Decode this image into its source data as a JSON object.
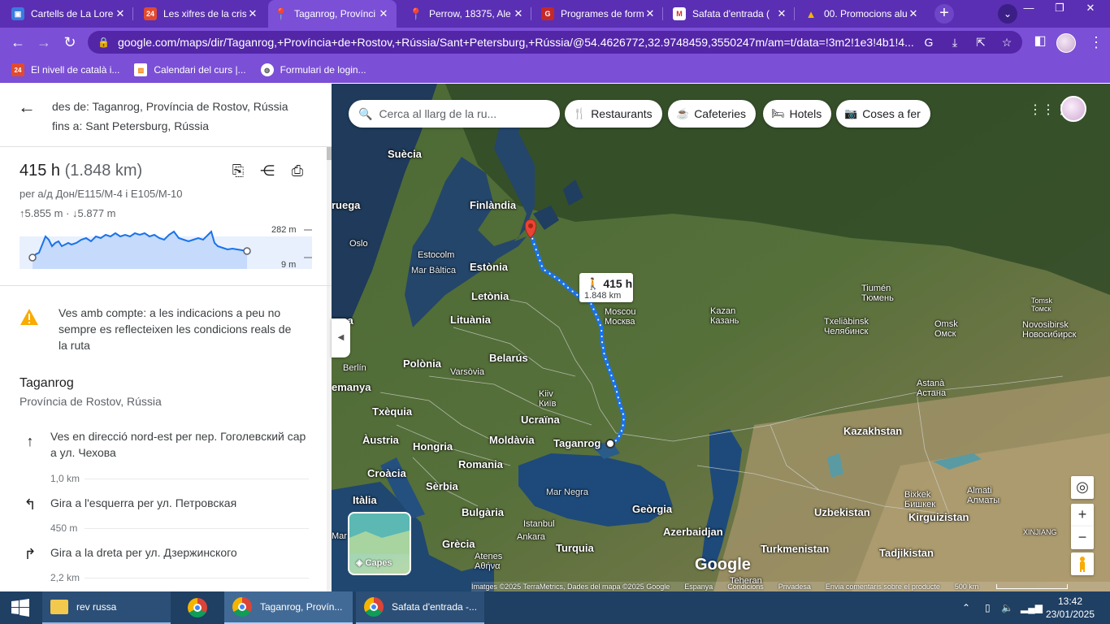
{
  "browser": {
    "tabs": [
      {
        "title": "Cartells de La Lore",
        "favicon": "yellow-square-icon",
        "color": "#3b7be0"
      },
      {
        "title": "Les xifres de la cris",
        "favicon": "324-icon",
        "color": "#e24a2f"
      },
      {
        "title": "Taganrog, Provínci",
        "favicon": "maps-pin-icon",
        "color": "#34a853"
      },
      {
        "title": "Perrow, 18375, Ale",
        "favicon": "maps-pin-icon",
        "color": "#34a853"
      },
      {
        "title": "Programes de form",
        "favicon": "gen-cat-icon",
        "color": "#c62828"
      },
      {
        "title": "Safata d'entrada (",
        "favicon": "gmail-icon",
        "color": "#d93025"
      },
      {
        "title": "00. Promocions alu",
        "favicon": "drive-icon",
        "color": "#1e8e3e"
      }
    ],
    "new_tab": "+",
    "url_domain": "google.com",
    "url_path": "/maps/dir/Taganrog,+Província+de+Rostov,+Rússia/Sant+Petersburg,+Rússia/@54.4626772,32.9748459,3550247m/am=t/data=!3m2!1e3!4b1!4...",
    "bookmarks": [
      {
        "label": "El nivell de català i...",
        "icon": "324-icon"
      },
      {
        "label": "Calendari del curs |...",
        "icon": "calendar-icon"
      },
      {
        "label": "Formulari de login...",
        "icon": "globe-icon"
      }
    ]
  },
  "directions": {
    "from": "des de: Taganrog, Província de Rostov, Rússia",
    "to": "fins a: Sant Petersburg, Rússia",
    "duration": "415 h",
    "distance": "(1.848 km)",
    "via": "per a/д Дон/E115/M-4 i E105/M-10",
    "elevation": "↑5.855 m · ↓5.877 m",
    "elev_max": "282 m",
    "elev_min": "9 m",
    "warning": "Ves amb compte: a les indicacions a peu no sempre es reflecteixen les condicions reals de la ruta",
    "origin_title": "Taganrog",
    "origin_sub": "Província de Rostov, Rússia",
    "steps": [
      {
        "icon": "arrow-up-icon",
        "text": "Ves en direcció nord-est per пер. Гоголевский сар a ул. Чехова",
        "km": "1,0 km"
      },
      {
        "icon": "turn-left-icon",
        "text": "Gira a l'esquerra per ул. Петровская",
        "km": "450 m"
      },
      {
        "icon": "turn-right-icon",
        "text": "Gira a la dreta per ул. Дзержинского",
        "km": "2,2 km"
      }
    ]
  },
  "map": {
    "search_placeholder": "Cerca al llarg de la ru...",
    "chips": [
      {
        "label": "Restaurants",
        "icon": "fork-knife-icon"
      },
      {
        "label": "Cafeteries",
        "icon": "coffee-icon"
      },
      {
        "label": "Hotels",
        "icon": "bed-icon"
      },
      {
        "label": "Coses a fer",
        "icon": "camera-icon"
      }
    ],
    "tooltip_time": "415 h",
    "tooltip_dist": "1.848 km",
    "layers_label": "Capes",
    "logo": "Google",
    "labels": {
      "suecia": "Suècia",
      "finlandia": "Finlàndia",
      "noruega": "ruega",
      "oslo": "Oslo",
      "estocolm": "Estocolm",
      "mar_baltica": "Mar Bàltica",
      "estonia": "Estònia",
      "letonia": "Letònia",
      "lituania": "Lituània",
      "dinamarca": "arca",
      "moscou": "Moscou",
      "moscou_ru": "Москва",
      "kazan": "Kazan",
      "kazan_ru": "Казань",
      "tiumen": "Tiumén",
      "tiumen_ru": "Тюмень",
      "txeliabinsk": "Txeliàbinsk",
      "txeliabinsk_ru": "Челябинск",
      "omsk": "Omsk",
      "omsk_ru": "Омск",
      "novosibirsk": "Novosibirsk",
      "novosibirsk_ru": "Новосибирск",
      "tomsk": "Tomsk",
      "tomsk_ru": "Томск",
      "berlin": "Berlín",
      "alemanya": "emanya",
      "polonia": "Polònia",
      "varsovia": "Varsòvia",
      "belarus": "Belarús",
      "kiiv": "Kiiv",
      "kiiv_ru": "Київ",
      "ucraina": "Ucraïna",
      "txequia": "Txèquia",
      "austria": "Àustria",
      "hongria": "Hongria",
      "moldavia": "Moldàvia",
      "taganrog": "Taganrog",
      "croacia": "Croàcia",
      "romania": "Romania",
      "serbia": "Sèrbia",
      "italia": "Itàlia",
      "bulgaria": "Bulgària",
      "mar_negra": "Mar Negra",
      "istanbul": "Istanbul",
      "ankara": "Ankara",
      "turquia": "Turquia",
      "georgia": "Geòrgia",
      "azerbaidjan": "Azerbaidjan",
      "grecia": "Grècia",
      "atenes": "Atenes",
      "atenes_gr": "Αθήνα",
      "astana": "Astanà",
      "astana_ru": "Астана",
      "kazakhstan": "Kazakhstan",
      "uzbekistan": "Uzbekistan",
      "turkmenistan": "Turkmenistan",
      "bixkek": "Bixkek",
      "bixkek_ru": "Бишкек",
      "almati": "Almati",
      "almati_ru": "Алматы",
      "kirguizistan": "Kirguizistan",
      "xinjiang": "XINJIANG",
      "tadjikistan": "Tadjikistan",
      "teheran": "Teheran",
      "mar": "Mar"
    },
    "attribution": [
      "Imatges ©2025 TerraMetrics, Dades del mapa ©2025 Google",
      "Espanya",
      "Condicions",
      "Privadesa",
      "Envia comentaris sobre el producte",
      "500 km"
    ]
  },
  "taskbar": {
    "items": [
      {
        "label": "rev russa",
        "icon": "folder-icon"
      },
      {
        "label": "",
        "icon": "chrome-icon"
      },
      {
        "label": "Taganrog, Provín...",
        "icon": "chrome-icon"
      },
      {
        "label": "Safata d'entrada -...",
        "icon": "chrome-icon"
      }
    ],
    "time": "13:42",
    "date": "23/01/2025"
  },
  "colors": {
    "chrome_purple": "#7b4fd6",
    "tab_strip": "#5a2fb3",
    "route_blue": "#1a73e8",
    "destination_red": "#ea4335",
    "taskbar": "#1f3f63"
  }
}
